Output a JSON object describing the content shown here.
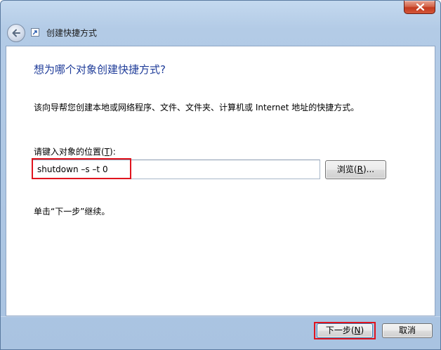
{
  "window": {
    "title": "创建快捷方式"
  },
  "content": {
    "heading": "想为哪个对象创建快捷方式?",
    "description": "该向导帮您创建本地或网络程序、文件、文件夹、计算机或 Internet 地址的快捷方式。",
    "location_label_prefix": "请键入对象的位置(",
    "location_label_hotkey": "T",
    "location_label_suffix": "):",
    "location_value": "shutdown –s –t 0",
    "browse_prefix": "浏览(",
    "browse_hotkey": "R",
    "browse_suffix": ")...",
    "hint": "单击“下一步”继续。"
  },
  "footer": {
    "next_prefix": "下一步(",
    "next_hotkey": "N",
    "next_suffix": ")",
    "cancel_label": "取消"
  },
  "icons": {
    "close": "close-icon",
    "back": "back-arrow-icon",
    "shortcut": "shortcut-icon"
  },
  "colors": {
    "heading": "#1f3c99",
    "highlight": "#e0141e",
    "close_button": "#c33a1f"
  }
}
